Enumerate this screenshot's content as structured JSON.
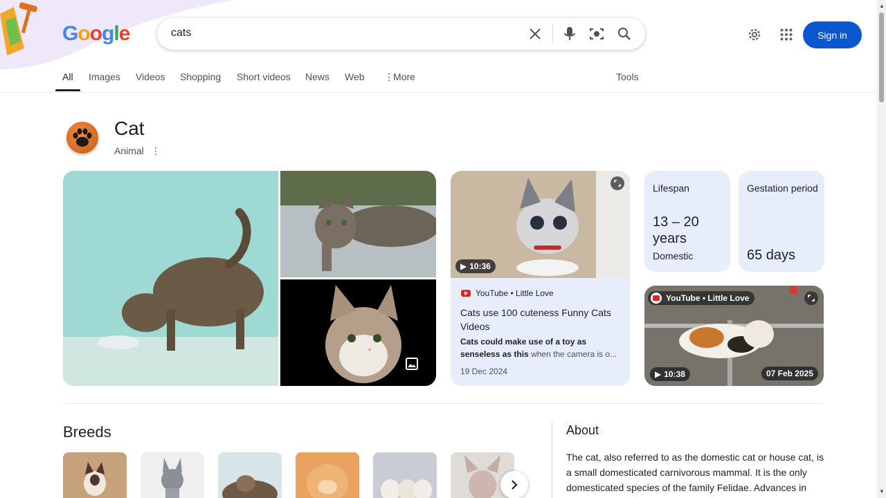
{
  "search": {
    "query": "cats"
  },
  "logo": {
    "letters": [
      "G",
      "o",
      "o",
      "g",
      "l",
      "e"
    ]
  },
  "header": {
    "sign_in_label": "Sign in",
    "icons": [
      "settings-gear-icon",
      "apps-grid-icon"
    ]
  },
  "tabs": [
    {
      "label": "All",
      "active": true
    },
    {
      "label": "Images"
    },
    {
      "label": "Videos"
    },
    {
      "label": "Shopping"
    },
    {
      "label": "Short videos"
    },
    {
      "label": "News"
    },
    {
      "label": "Web"
    },
    {
      "label": "More"
    },
    {
      "label": "Tools"
    }
  ],
  "entity": {
    "title": "Cat",
    "subtitle": "Animal"
  },
  "video_card": {
    "duration": "10:36",
    "source": "YouTube • Little Love",
    "title": "Cats use 100 cuteness Funny Cats Videos",
    "snippet_bold": "Cats could make use of a toy as senseless as this",
    "snippet_rest": " when the camera is o...",
    "date": "19 Dec 2024"
  },
  "facts": [
    {
      "label": "Lifespan",
      "value": "13 – 20 years",
      "note": "Domestic"
    },
    {
      "label": "Gestation period",
      "value": "65 days"
    }
  ],
  "video_card_2": {
    "source": "YouTube • Little Love",
    "duration": "10:38",
    "date": "07 Feb 2025"
  },
  "breeds": {
    "title": "Breeds"
  },
  "about": {
    "title": "About",
    "text": "The cat, also referred to as the domestic cat or house cat, is a small domesticated carnivorous mammal. It is the only domesticated species of the family Felidae. Advances in"
  },
  "colors": {
    "accent_blue": "#0b57d0",
    "card_bg": "#e8edfb",
    "youtube_red": "#e62117"
  }
}
